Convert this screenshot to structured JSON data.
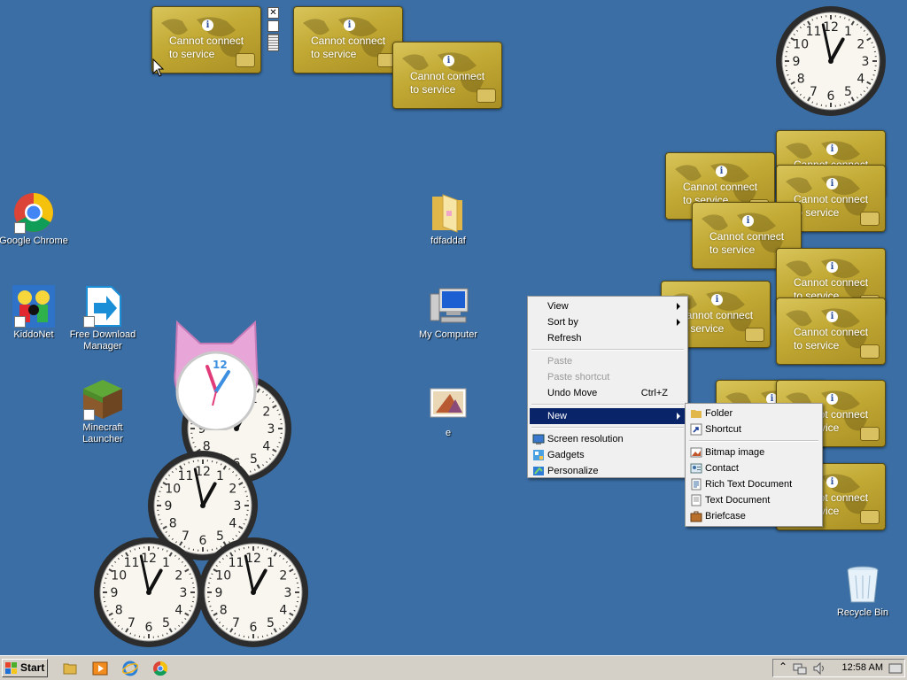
{
  "gadget_message": "Cannot connect\nto service",
  "info_symbol": "i",
  "desktop_icons": [
    {
      "label": "Google Chrome",
      "icon": "chrome-icon"
    },
    {
      "label": "KiddoNet",
      "icon": "kiddonet-icon"
    },
    {
      "label": "Free Download\nManager",
      "icon": "free-download-manager-icon"
    },
    {
      "label": "Minecraft\nLauncher",
      "icon": "minecraft-icon"
    },
    {
      "label": "fdfaddaf",
      "icon": "folder-icon"
    },
    {
      "label": "My Computer",
      "icon": "my-computer-icon"
    },
    {
      "label": "e",
      "icon": "image-file-icon"
    },
    {
      "label": "Recycle Bin",
      "icon": "recycle-bin-icon"
    }
  ],
  "context_menu": {
    "view": "View",
    "sort_by": "Sort by",
    "refresh": "Refresh",
    "paste": "Paste",
    "paste_shortcut": "Paste shortcut",
    "undo_move": "Undo Move",
    "undo_shortcut": "Ctrl+Z",
    "new": "New",
    "screen_resolution": "Screen resolution",
    "gadgets": "Gadgets",
    "personalize": "Personalize"
  },
  "new_submenu": {
    "folder": "Folder",
    "shortcut": "Shortcut",
    "bitmap": "Bitmap image",
    "contact": "Contact",
    "rtf": "Rich Text Document",
    "text": "Text Document",
    "briefcase": "Briefcase"
  },
  "taskbar": {
    "start_label": "Start",
    "time": "12:58 AM",
    "quick_launch": [
      "explorer-icon",
      "media-player-icon",
      "internet-explorer-icon",
      "chrome-icon"
    ]
  },
  "clock_time": {
    "hours": 0,
    "minutes": 58
  },
  "colors": {
    "desktop": "#3a6ea5",
    "menu_highlight": "#0a246a",
    "gadget_gold": "#c2a934"
  }
}
